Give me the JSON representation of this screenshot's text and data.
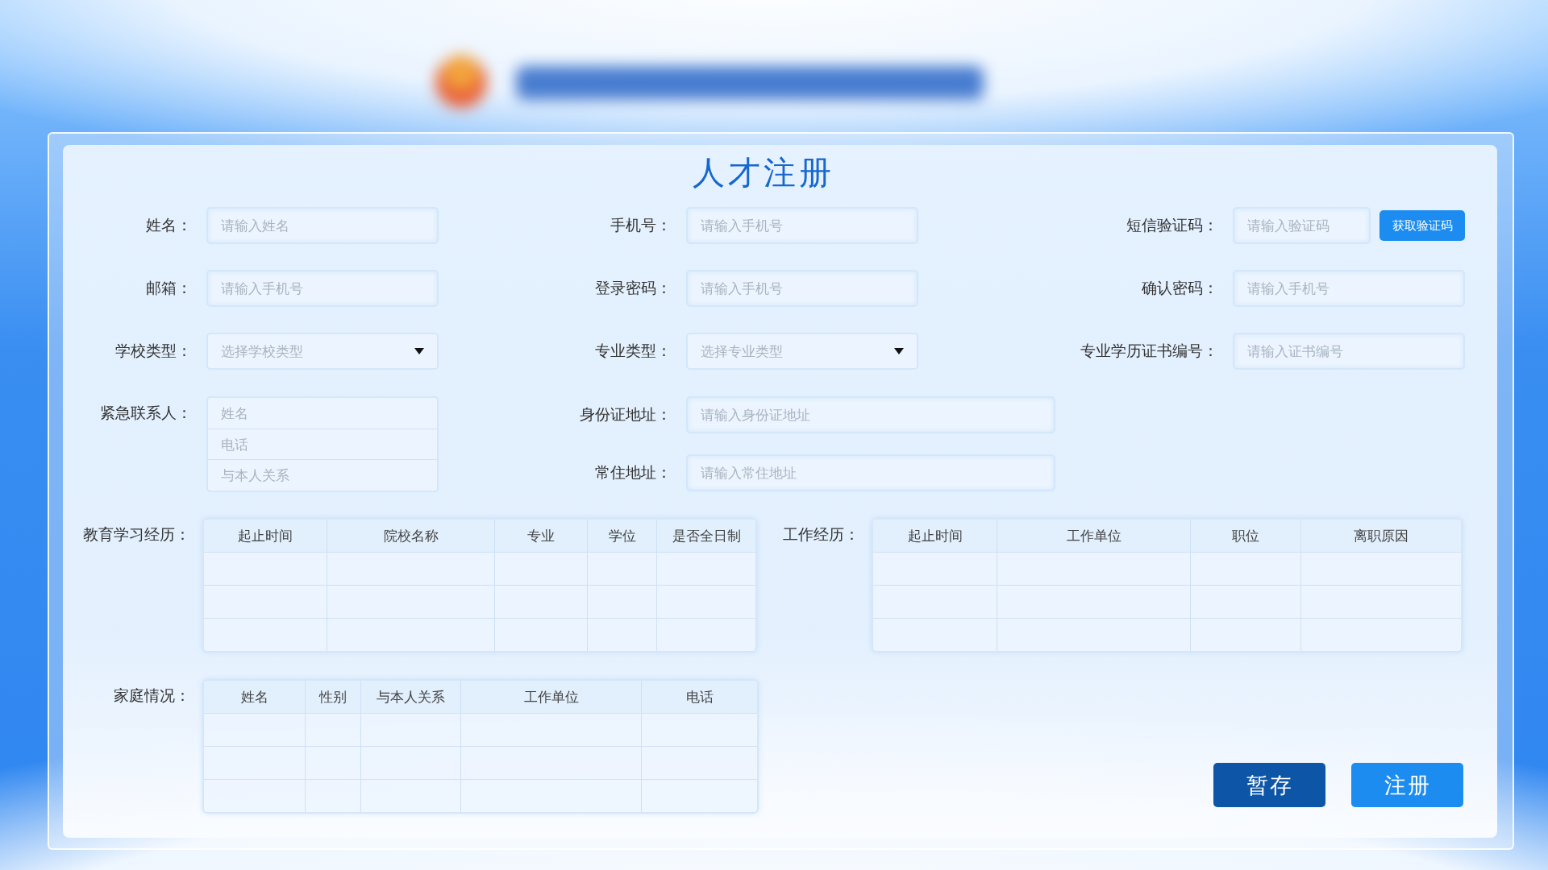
{
  "title": "人才注册",
  "rows": [
    [
      {
        "label": "姓名：",
        "kind": "text",
        "placeholder": "请输入姓名"
      },
      {
        "label": "手机号：",
        "kind": "text",
        "placeholder": "请输入手机号"
      },
      {
        "label": "短信验证码：",
        "kind": "code",
        "placeholder": "请输入验证码",
        "button": "获取验证码"
      }
    ],
    [
      {
        "label": "邮箱：",
        "kind": "text",
        "placeholder": "请输入手机号"
      },
      {
        "label": "登录密码：",
        "kind": "text",
        "placeholder": "请输入手机号"
      },
      {
        "label": "确认密码：",
        "kind": "text",
        "placeholder": "请输入手机号"
      }
    ],
    [
      {
        "label": "学校类型：",
        "kind": "select",
        "placeholder": "选择学校类型"
      },
      {
        "label": "专业类型：",
        "kind": "select",
        "placeholder": "选择专业类型"
      },
      {
        "label": "专业学历证书编号：",
        "kind": "text",
        "placeholder": "请输入证书编号"
      }
    ]
  ],
  "emergency": {
    "label": "紧急联系人：",
    "placeholders": [
      "姓名",
      "电话",
      "与本人关系"
    ]
  },
  "addresses": [
    {
      "label": "身份证地址：",
      "placeholder": "请输入身份证地址"
    },
    {
      "label": "常住地址：",
      "placeholder": "请输入常住地址"
    }
  ],
  "education": {
    "label": "教育学习经历：",
    "columns": [
      "起止时间",
      "院校名称",
      "专业",
      "学位",
      "是否全日制"
    ]
  },
  "work": {
    "label": "工作经历：",
    "columns": [
      "起止时间",
      "工作单位",
      "职位",
      "离职原因"
    ]
  },
  "family": {
    "label": "家庭情况：",
    "columns": [
      "姓名",
      "性别",
      "与本人关系",
      "工作单位",
      "电话"
    ]
  },
  "buttons": [
    {
      "label": "暂存",
      "kind": "secondary"
    },
    {
      "label": "注册",
      "kind": "primary"
    }
  ]
}
